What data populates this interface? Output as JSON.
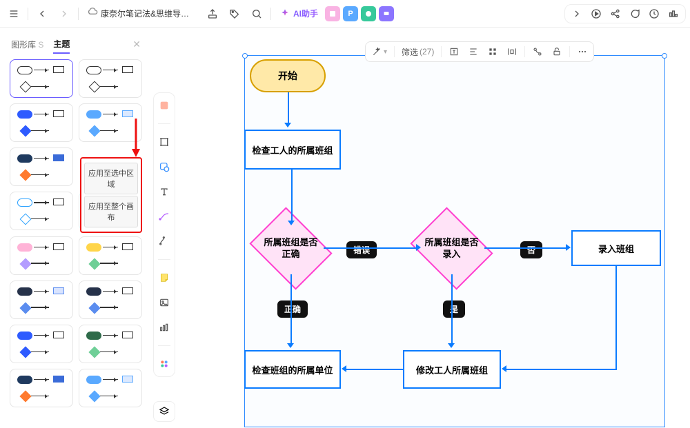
{
  "header": {
    "doc_title": "康奈尔笔记法&思维导图笔…",
    "ai_label": "AI助手"
  },
  "sidebar": {
    "tab_shapes": "图形库",
    "tab_shapes_suffix": "S",
    "tab_theme": "主题"
  },
  "popover": {
    "apply_selection": "应用至选中区域",
    "apply_canvas": "应用至整个画布"
  },
  "canvas_toolbar": {
    "filter_label": "筛选",
    "filter_count": "(27)"
  },
  "flow": {
    "start": "开始",
    "check_group": "检查工人的所属班组",
    "group_correct_q": "所属班组是否正确",
    "label_wrong": "错误",
    "label_correct": "正确",
    "group_entered_q": "所属班组是否录入",
    "label_no": "否",
    "label_yes": "是",
    "enter_group": "录入班组",
    "modify_group": "修改工人所属班组",
    "check_unit": "检查班组的所属单位"
  }
}
